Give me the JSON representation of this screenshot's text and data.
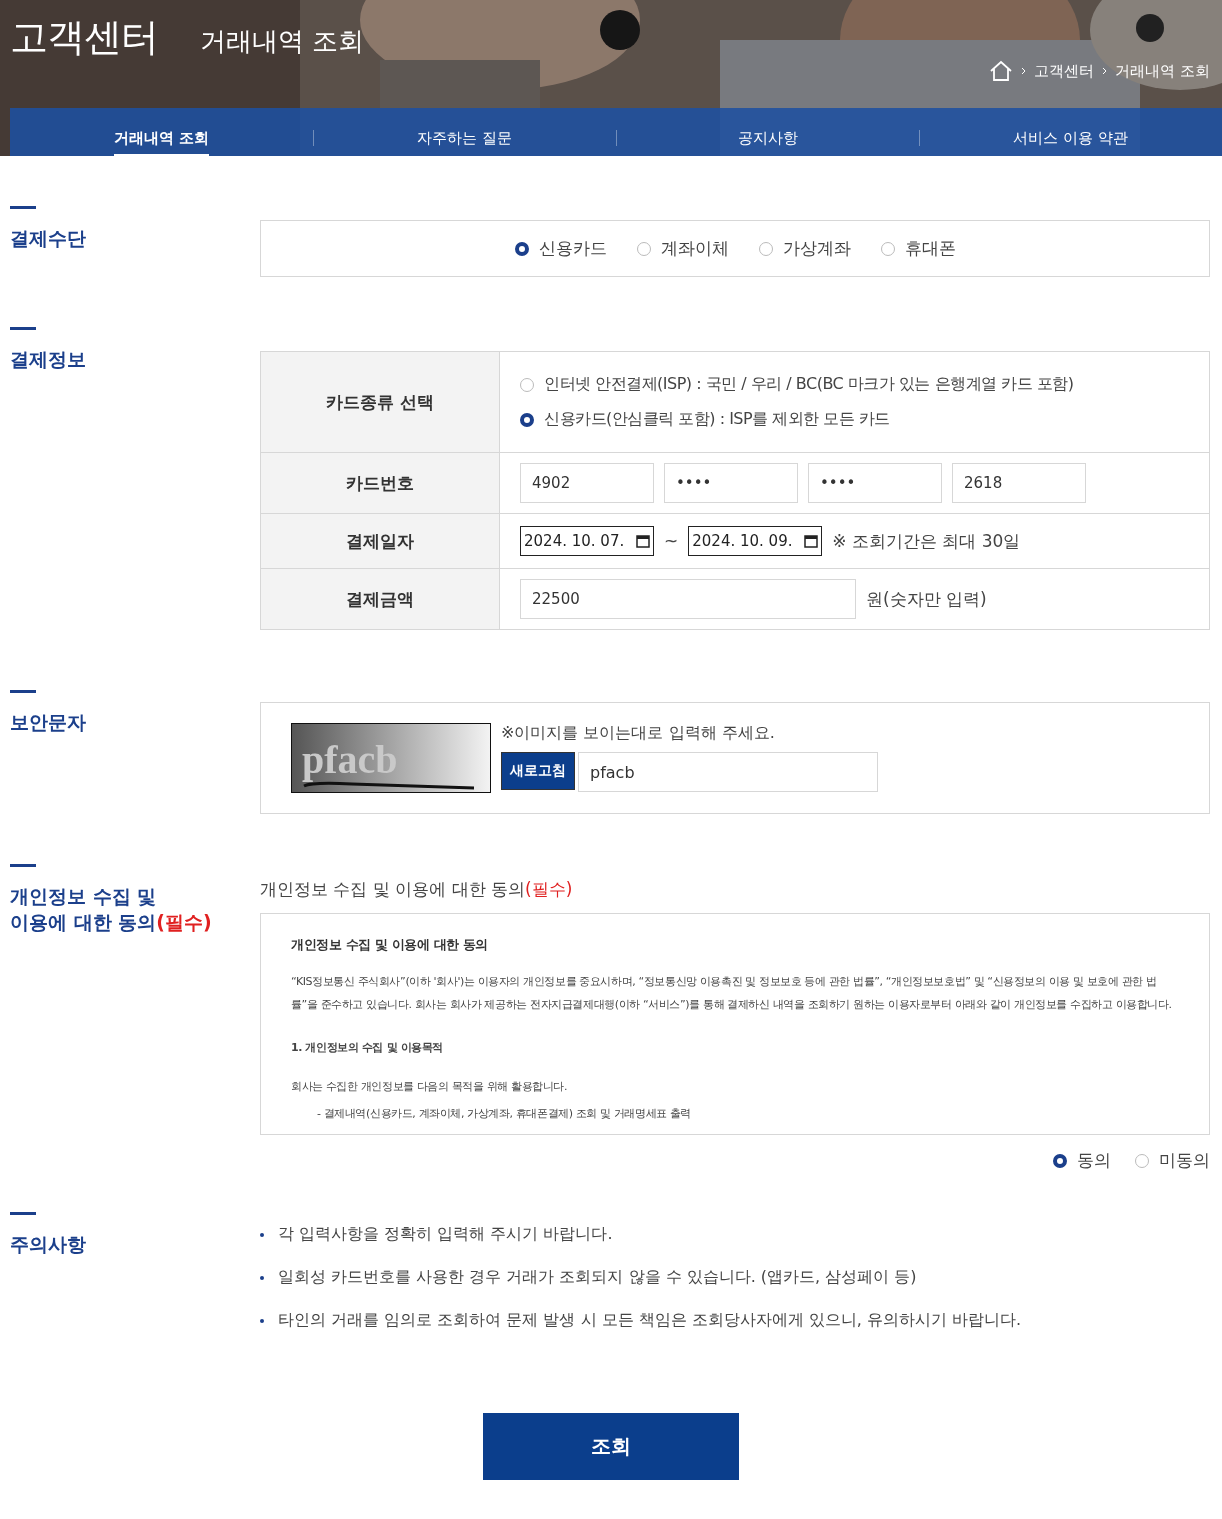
{
  "header": {
    "title": "고객센터",
    "subtitle": "거래내역 조회",
    "breadcrumb": [
      "고객센터",
      "거래내역 조회"
    ]
  },
  "nav": [
    {
      "label": "거래내역 조회",
      "selected": true
    },
    {
      "label": "자주하는 질문",
      "selected": false
    },
    {
      "label": "공지사항",
      "selected": false
    },
    {
      "label": "서비스 이용 약관",
      "selected": false
    }
  ],
  "payment_method": {
    "heading": "결제수단",
    "options": [
      {
        "label": "신용카드",
        "selected": true
      },
      {
        "label": "계좌이체",
        "selected": false
      },
      {
        "label": "가상계좌",
        "selected": false
      },
      {
        "label": "휴대폰",
        "selected": false
      }
    ]
  },
  "payment_info": {
    "heading": "결제정보",
    "card_type": {
      "label": "카드종류 선택",
      "options": [
        {
          "label": "인터넷 안전결제(ISP) : 국민 / 우리 / BC(BC 마크가 있는 은행계열 카드 포함)",
          "selected": false
        },
        {
          "label": "신용카드(안심클릭 포함) : ISP를 제외한 모든 카드",
          "selected": true
        }
      ]
    },
    "card_number": {
      "label": "카드번호",
      "parts": [
        "4902",
        "••••",
        "••••",
        "2618"
      ]
    },
    "date": {
      "label": "결제일자",
      "from": "2024. 10. 07.",
      "separator": "~",
      "to": "2024. 10. 09.",
      "note": "※ 조회기간은 최대 30일"
    },
    "amount": {
      "label": "결제금액",
      "value": "22500",
      "unit": "원(숫자만 입력)"
    }
  },
  "security": {
    "heading": "보안문자",
    "captcha_text": "pfacb",
    "hint": "※이미지를 보이는대로 입력해 주세요.",
    "refresh": "새로고침",
    "value": "pfacb"
  },
  "consent": {
    "heading": "개인정보 수집 및\n이용에 대한 동의",
    "heading_required": "(필수)",
    "title": "개인정보 수집 및 이용에 대한 동의",
    "title_required": "(필수)",
    "box_title": "개인정보 수집 및 이용에 대한 동의",
    "paragraphs": [
      {
        "kind": "text",
        "text": "“KIS정보통신 주식회사”(이하 '회사')는 이용자의 개인정보를 중요시하며, “정보통신망 이용촉진 및 정보보호 등에 관한 법률”, “개인정보보호법” 및 “신용정보의 이용 및 보호에 관한 법률”을 준수하고 있습니다. 회사는 회사가 제공하는 전자지급결제대행(이하 “서비스”)를 통해 결제하신 내역을 조회하기 원하는 이용자로부터 아래와 같이 개인정보를 수집하고 이용합니다."
      },
      {
        "kind": "heading",
        "text": "1. 개인정보의 수집 및 이용목적"
      },
      {
        "kind": "text",
        "text": "회사는 수집한 개인정보를 다음의 목적을 위해 활용합니다."
      },
      {
        "kind": "item",
        "text": "- 결제내역(신용카드, 계좌이체, 가상계좌, 휴대폰결제) 조회 및 거래명세표 출력"
      }
    ],
    "options": [
      {
        "label": "동의",
        "selected": true
      },
      {
        "label": "미동의",
        "selected": false
      }
    ]
  },
  "notice": {
    "heading": "주의사항",
    "items": [
      "각 입력사항을 정확히 입력해 주시기 바랍니다.",
      "일회성 카드번호를 사용한 경우 거래가 조회되지 않을 수 있습니다. (앱카드, 삼성페이 등)",
      "타인의 거래를 임의로 조회하여 문제 발생 시 모든 책임은 조회당사자에게 있으니, 유의하시기 바랍니다."
    ]
  },
  "submit": "조회"
}
